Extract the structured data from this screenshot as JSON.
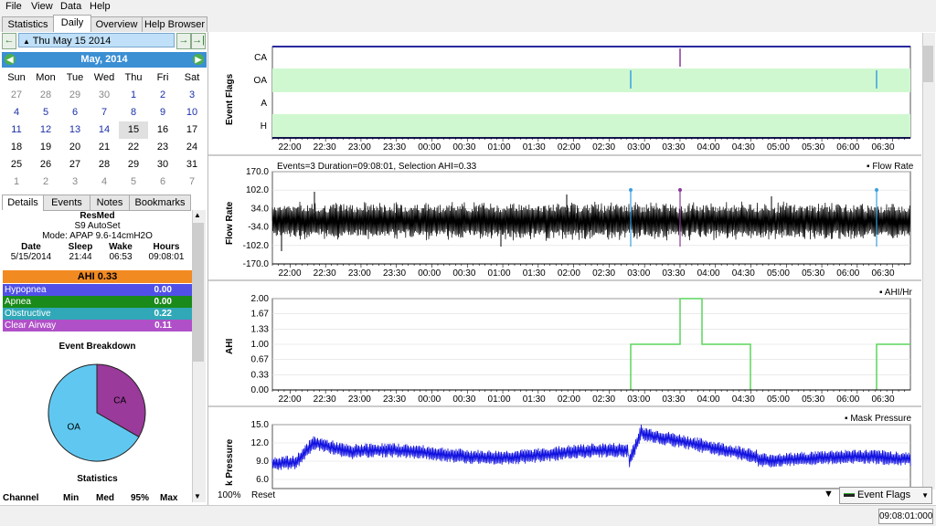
{
  "menu": [
    "File",
    "View",
    "Data",
    "Help"
  ],
  "main_tabs": [
    "Statistics",
    "Daily",
    "Overview",
    "Help Browser"
  ],
  "date_nav": {
    "prev": "←",
    "date": "Thu May 15 2014",
    "next": "→",
    "end": "→|"
  },
  "calendar": {
    "month_label": "May,  2014",
    "weekdays": [
      "Sun",
      "Mon",
      "Tue",
      "Wed",
      "Thu",
      "Fri",
      "Sat"
    ],
    "rows": [
      [
        "27",
        "28",
        "29",
        "30",
        "1",
        "2",
        "3"
      ],
      [
        "4",
        "5",
        "6",
        "7",
        "8",
        "9",
        "10"
      ],
      [
        "11",
        "12",
        "13",
        "14",
        "15",
        "16",
        "17"
      ],
      [
        "18",
        "19",
        "20",
        "21",
        "22",
        "23",
        "24"
      ],
      [
        "25",
        "26",
        "27",
        "28",
        "29",
        "30",
        "31"
      ],
      [
        "1",
        "2",
        "3",
        "4",
        "5",
        "6",
        "7"
      ]
    ]
  },
  "detail_tabs": [
    "Details",
    "Events",
    "Notes",
    "Bookmarks"
  ],
  "machine": {
    "brand": "ResMed",
    "model": "S9 AutoSet",
    "mode": "Mode: APAP 9.6-14cmH2O"
  },
  "session": {
    "headers": [
      "Date",
      "Sleep",
      "Wake",
      "Hours"
    ],
    "values": [
      "5/15/2014",
      "21:44",
      "06:53",
      "09:08:01"
    ]
  },
  "ahi": {
    "label": "AHI 0.33",
    "events": [
      {
        "name": "Hypopnea",
        "value": "0.00",
        "color": "#5050e8"
      },
      {
        "name": "Apnea",
        "value": "0.00",
        "color": "#1a8a1a"
      },
      {
        "name": "Obstructive",
        "value": "0.22",
        "color": "#30a8b8"
      },
      {
        "name": "Clear Airway",
        "value": "0.11",
        "color": "#b050c8"
      }
    ]
  },
  "breakdown": {
    "title": "Event Breakdown",
    "slices": [
      {
        "label": "CA",
        "fraction": 0.333,
        "color": "#9a3a9a"
      },
      {
        "label": "OA",
        "fraction": 0.667,
        "color": "#60c8f0"
      }
    ]
  },
  "stats": {
    "title": "Statistics",
    "headers": [
      "Channel",
      "Min",
      "Med",
      "95%",
      "Max"
    ]
  },
  "time_ticks": [
    "22:00",
    "22:30",
    "23:00",
    "23:30",
    "00:00",
    "00:30",
    "01:00",
    "01:30",
    "02:00",
    "02:30",
    "03:00",
    "03:30",
    "04:00",
    "04:30",
    "05:00",
    "05:30",
    "06:00",
    "06:30"
  ],
  "graphs": {
    "event_flags": {
      "ylabel": "Event Flags",
      "rows": [
        "CA",
        "OA",
        "A",
        "H"
      ]
    },
    "flow_rate": {
      "ylabel": "Flow Rate",
      "header": "Events=3 Duration=09:08:01, Selection AHI=0.33",
      "legend": "Flow Rate",
      "ticks": [
        "170.0",
        "102.0",
        "34.0",
        "-34.0",
        "-102.0",
        "-170.0"
      ]
    },
    "ahi_hr": {
      "ylabel": "AHI",
      "legend": "AHI/Hr",
      "ticks": [
        "2.00",
        "1.67",
        "1.33",
        "1.00",
        "0.67",
        "0.33",
        "0.00"
      ]
    },
    "mask_pressure": {
      "ylabel": "k Pressure",
      "legend": "Mask Pressure",
      "ticks": [
        "15.0",
        "12.0",
        "9.0",
        "6.0"
      ]
    }
  },
  "bottom": {
    "zoom": "100%",
    "reset": "Reset",
    "dropdown": "Event Flags"
  },
  "status": {
    "duration": "09:08:01:000"
  }
}
